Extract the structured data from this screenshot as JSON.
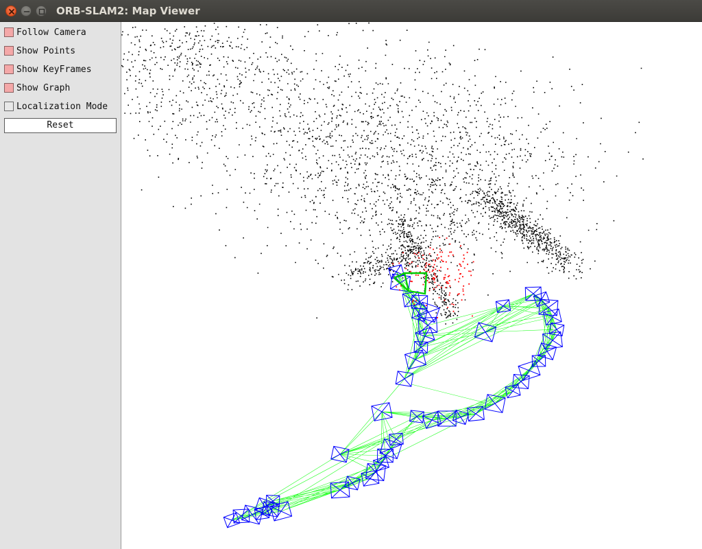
{
  "window": {
    "title": "ORB-SLAM2: Map Viewer",
    "controls": [
      "close-icon",
      "minimize-icon",
      "maximize-icon"
    ]
  },
  "panel": {
    "options": [
      {
        "label": "Follow Camera",
        "checked": true
      },
      {
        "label": "Show Points",
        "checked": true
      },
      {
        "label": "Show KeyFrames",
        "checked": true
      },
      {
        "label": "Show Graph",
        "checked": true
      },
      {
        "label": "Localization Mode",
        "checked": false
      }
    ],
    "reset_label": "Reset"
  },
  "colors": {
    "map_points": "#000000",
    "reference_points": "#ff0000",
    "keyframes": "#0000ff",
    "covisibility_graph": "#00ff00",
    "current_camera": "#00cc00",
    "checkbox_on": "#f4a8a8",
    "titlebar": "#3c3b37"
  }
}
